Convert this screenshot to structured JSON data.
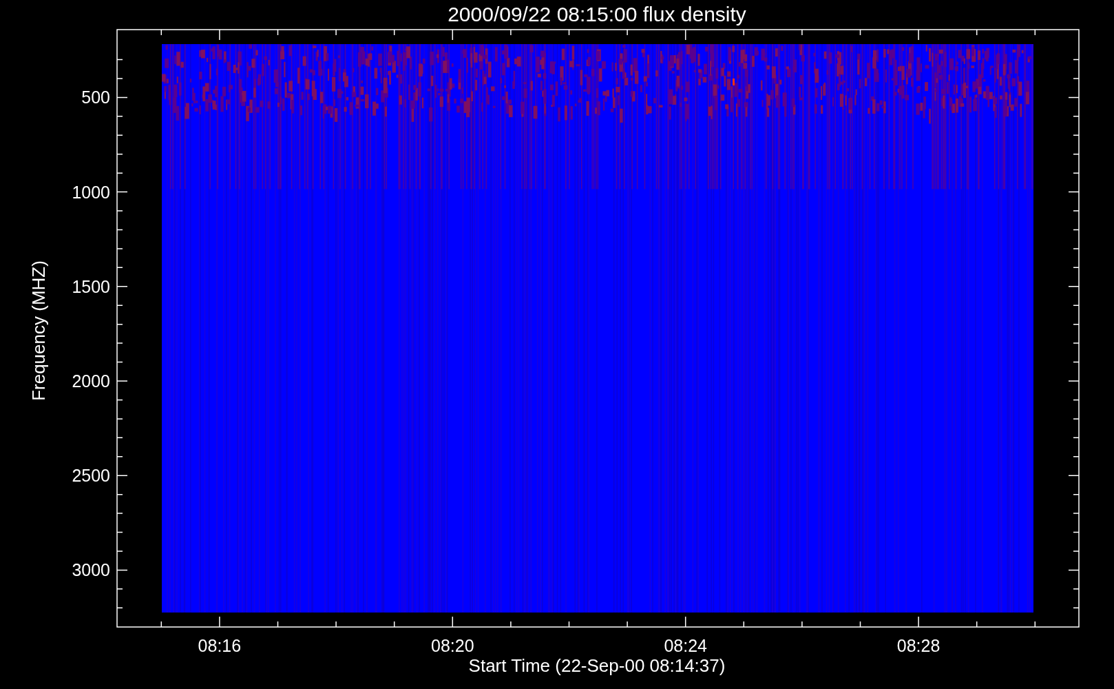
{
  "plot": {
    "title": "2000/09/22 08:15:00 flux density",
    "xlabel": "Start Time (22-Sep-00 08:14:37)",
    "ylabel": "Frequency (MHZ)",
    "xticks": [
      "08:16",
      "08:20",
      "08:24",
      "08:28"
    ],
    "yticks": [
      "500",
      "1000",
      "1500",
      "2000",
      "2500",
      "3000"
    ]
  }
}
